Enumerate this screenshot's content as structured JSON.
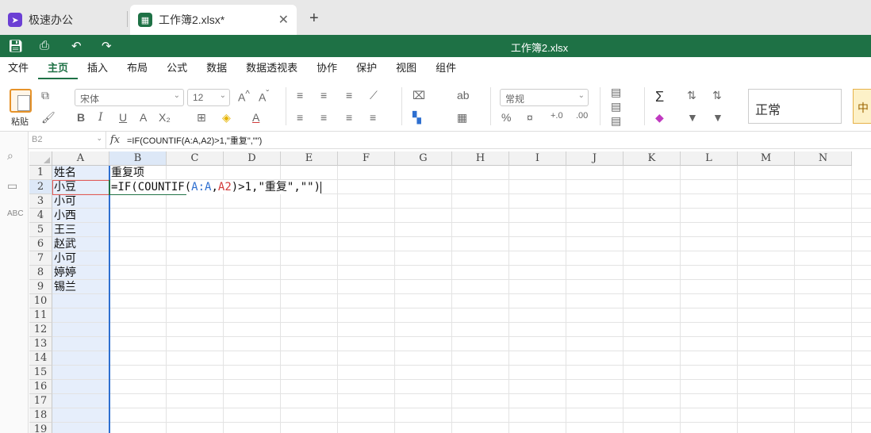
{
  "tabs": [
    {
      "label": "极速办公",
      "icon": "rocket-icon",
      "color": "#6b3fd4"
    },
    {
      "label": "工作簿2.xlsx*",
      "icon": "spreadsheet-icon",
      "color": "#1e7145"
    }
  ],
  "title": "工作簿2.xlsx",
  "menu": [
    "文件",
    "主页",
    "插入",
    "布局",
    "公式",
    "数据",
    "数据透视表",
    "协作",
    "保护",
    "视图",
    "组件"
  ],
  "ribbon": {
    "paste_label": "粘贴",
    "font_name": "宋体",
    "font_size": "12",
    "number_format": "常规",
    "style_normal": "正常",
    "style_neutral": "中"
  },
  "formula_bar": {
    "cell_ref": "B2",
    "fx": "fx",
    "formula": "=IF(COUNTIF(A:A,A2)>1,\"重复\",\"\")"
  },
  "columns": [
    "A",
    "B",
    "C",
    "D",
    "E",
    "F",
    "G",
    "H",
    "I",
    "J",
    "K",
    "L",
    "M",
    "N"
  ],
  "rows": [
    "1",
    "2",
    "3",
    "4",
    "5",
    "6",
    "7",
    "8",
    "9",
    "10",
    "11",
    "12",
    "13",
    "14",
    "15",
    "16",
    "17",
    "18",
    "19"
  ],
  "cells": {
    "A1": "姓名",
    "B1": "重复项",
    "A2": "小豆",
    "A3": "小可",
    "A4": "小西",
    "A5": "王三",
    "A6": "赵武",
    "A7": "小可",
    "A8": "婷婷",
    "A9": "锡兰"
  },
  "editing": {
    "p1": "=IF(COUNTIF(",
    "ref1": "A:A",
    "comma": ",",
    "ref2": "A2",
    "p2": ")>1,\"重复\",\"\")"
  },
  "colors": {
    "accent": "#1e7145",
    "selected_col": "#e6eefb",
    "ref_blue": "#2e6fd0",
    "ref_red": "#d23a3a"
  }
}
